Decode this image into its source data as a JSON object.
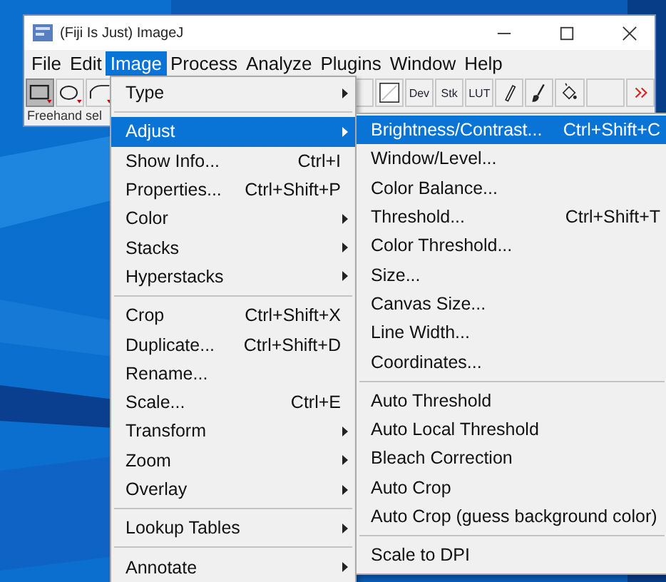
{
  "window": {
    "title": "(Fiji Is Just) ImageJ"
  },
  "menu_bar": [
    {
      "label": "File",
      "selected": false
    },
    {
      "label": "Edit",
      "selected": false
    },
    {
      "label": "Image",
      "selected": true
    },
    {
      "label": "Process",
      "selected": false
    },
    {
      "label": "Analyze",
      "selected": false
    },
    {
      "label": "Plugins",
      "selected": false
    },
    {
      "label": "Window",
      "selected": false
    },
    {
      "label": "Help",
      "selected": false
    }
  ],
  "toolbar": {
    "left_tools": [
      {
        "kind": "rectangle",
        "selected": true
      },
      {
        "kind": "oval",
        "selected": false
      },
      {
        "kind": "polygon",
        "selected": false
      }
    ],
    "right_tools": [
      {
        "kind": "blank"
      },
      {
        "kind": "square"
      },
      {
        "kind": "text",
        "label": "Dev"
      },
      {
        "kind": "text",
        "label": "Stk"
      },
      {
        "kind": "text",
        "label": "LUT"
      },
      {
        "kind": "pencil"
      },
      {
        "kind": "brush"
      },
      {
        "kind": "fill"
      },
      {
        "kind": "blank"
      },
      {
        "kind": "more"
      }
    ]
  },
  "status_bar": {
    "text": "Freehand sel"
  },
  "image_menu": [
    {
      "kind": "item",
      "label": "Type",
      "submenu": true,
      "selected": false
    },
    {
      "kind": "separator"
    },
    {
      "kind": "item",
      "label": "Adjust",
      "submenu": true,
      "selected": true
    },
    {
      "kind": "item",
      "label": "Show Info...",
      "shortcut": "Ctrl+I",
      "submenu": false,
      "selected": false
    },
    {
      "kind": "item",
      "label": "Properties...",
      "shortcut": "Ctrl+Shift+P",
      "submenu": false,
      "selected": false
    },
    {
      "kind": "item",
      "label": "Color",
      "submenu": true,
      "selected": false
    },
    {
      "kind": "item",
      "label": "Stacks",
      "submenu": true,
      "selected": false
    },
    {
      "kind": "item",
      "label": "Hyperstacks",
      "submenu": true,
      "selected": false
    },
    {
      "kind": "separator"
    },
    {
      "kind": "item",
      "label": "Crop",
      "shortcut": "Ctrl+Shift+X",
      "submenu": false,
      "selected": false
    },
    {
      "kind": "item",
      "label": "Duplicate...",
      "shortcut": "Ctrl+Shift+D",
      "submenu": false,
      "selected": false
    },
    {
      "kind": "item",
      "label": "Rename...",
      "submenu": false,
      "selected": false
    },
    {
      "kind": "item",
      "label": "Scale...",
      "shortcut": "Ctrl+E",
      "submenu": false,
      "selected": false
    },
    {
      "kind": "item",
      "label": "Transform",
      "submenu": true,
      "selected": false
    },
    {
      "kind": "item",
      "label": "Zoom",
      "submenu": true,
      "selected": false
    },
    {
      "kind": "item",
      "label": "Overlay",
      "submenu": true,
      "selected": false
    },
    {
      "kind": "separator"
    },
    {
      "kind": "item",
      "label": "Lookup Tables",
      "submenu": true,
      "selected": false
    },
    {
      "kind": "separator"
    },
    {
      "kind": "item",
      "label": "Annotate",
      "submenu": true,
      "selected": false
    }
  ],
  "adjust_submenu": [
    {
      "kind": "item",
      "label": "Brightness/Contrast...",
      "shortcut": "Ctrl+Shift+C",
      "selected": true
    },
    {
      "kind": "item",
      "label": "Window/Level...",
      "selected": false
    },
    {
      "kind": "item",
      "label": "Color Balance...",
      "selected": false
    },
    {
      "kind": "item",
      "label": "Threshold...",
      "shortcut": "Ctrl+Shift+T",
      "selected": false
    },
    {
      "kind": "item",
      "label": "Color Threshold...",
      "selected": false
    },
    {
      "kind": "item",
      "label": "Size...",
      "selected": false
    },
    {
      "kind": "item",
      "label": "Canvas Size...",
      "selected": false
    },
    {
      "kind": "item",
      "label": "Line Width...",
      "selected": false
    },
    {
      "kind": "item",
      "label": "Coordinates...",
      "selected": false
    },
    {
      "kind": "separator"
    },
    {
      "kind": "item",
      "label": "Auto Threshold",
      "selected": false
    },
    {
      "kind": "item",
      "label": "Auto Local Threshold",
      "selected": false
    },
    {
      "kind": "item",
      "label": "Bleach Correction",
      "selected": false
    },
    {
      "kind": "item",
      "label": "Auto Crop",
      "selected": false
    },
    {
      "kind": "item",
      "label": "Auto Crop (guess background color)",
      "selected": false
    },
    {
      "kind": "separator"
    },
    {
      "kind": "item",
      "label": "Scale to DPI",
      "selected": false
    }
  ]
}
